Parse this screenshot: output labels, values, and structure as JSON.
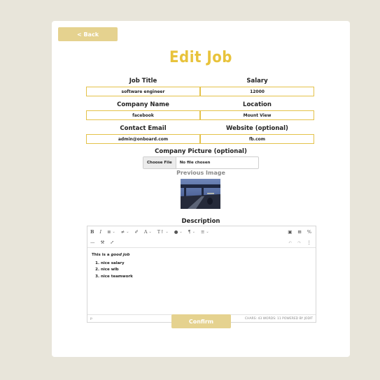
{
  "nav": {
    "back_label": "< Back"
  },
  "page": {
    "title": "Edit Job"
  },
  "form": {
    "job_title_label": "Job Title",
    "job_title_value": "software engineer",
    "salary_label": "Salary",
    "salary_value": "12000",
    "company_name_label": "Company Name",
    "company_name_value": "facebook",
    "location_label": "Location",
    "location_value": "Mount View",
    "contact_email_label": "Contact Email",
    "contact_email_value": "admin@onboard.com",
    "website_label": "Website (optional)",
    "website_value": "fb.com",
    "company_picture_label": "Company Picture (optional)",
    "choose_file_label": "Choose File",
    "no_file_text": "No file chosen",
    "previous_image_label": "Previous Image",
    "description_label": "Description",
    "confirm_label": "Confirm"
  },
  "editor": {
    "toolbar": {
      "bold": "B",
      "italic": "I",
      "ul": "≣",
      "ol": "≠",
      "eraser": "✐",
      "font": "A",
      "size": "T↑",
      "color": "●",
      "paragraph": "¶",
      "align": "≡",
      "image": "▣",
      "table": "⊞",
      "link": "%",
      "hr": "—",
      "brush": "⚒",
      "fullsize": "⤢",
      "undo": "↶",
      "redo": "↷",
      "more": "⋮"
    },
    "content": {
      "intro_prefix": "This is a ",
      "intro_emphasis": "good job",
      "items": [
        "nice salary",
        "nice wlb",
        "nice teamwork"
      ]
    },
    "status": {
      "path": "p",
      "counts": "CHARS: 43  WORDS: 11  POWERED BY JODIT"
    }
  }
}
